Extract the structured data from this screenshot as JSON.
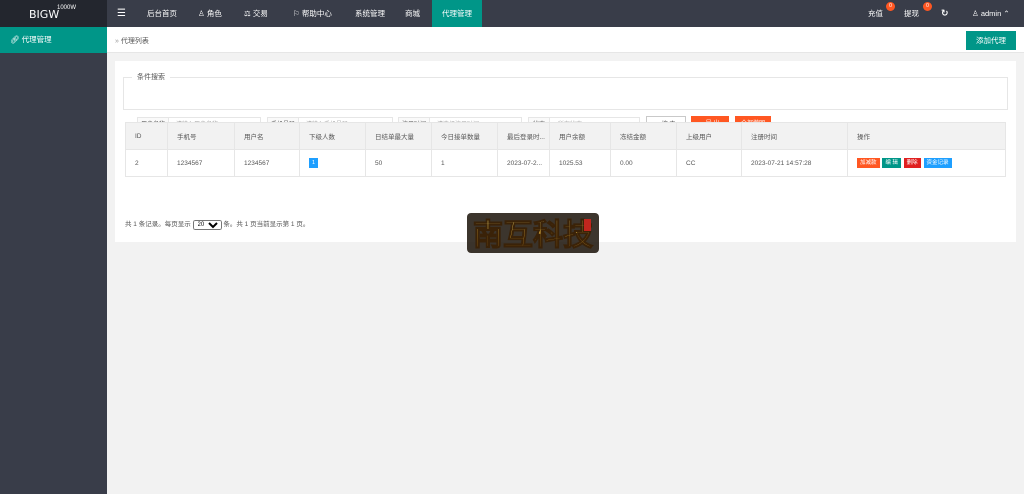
{
  "header": {
    "brand": "BIGW",
    "brand_sup": "1000W",
    "nav": [
      "后台首页",
      "角色",
      "交易",
      "帮助中心",
      "系统管理",
      "商城",
      "代理管理"
    ],
    "recharge": "充值",
    "recharge_badge": "0",
    "withdraw": "提现",
    "withdraw_badge": "0",
    "user": "admin"
  },
  "sidebar": {
    "items": [
      {
        "label": "代理管理"
      }
    ]
  },
  "breadcrumb": "代理列表",
  "add_button": "添加代理",
  "filter": {
    "legend": "条件搜索",
    "username_label": "用户名称",
    "username_placeholder": "请输入用户名称",
    "phone_label": "手机号码",
    "phone_placeholder": "请输入手机号码",
    "regtime_label": "注册时间",
    "regtime_placeholder": "请选择注册时间",
    "status_label": "状态",
    "status_value": "所有状态",
    "search": "搜 索",
    "export": "导 出",
    "batch": "全部撤回"
  },
  "table": {
    "columns": [
      "ID",
      "手机号",
      "用户名",
      "下级人数",
      "日结单最大量",
      "今日接单数量",
      "最后登录时...",
      "用户余额",
      "冻结金额",
      "上级用户",
      "注册时间",
      "操作"
    ],
    "rows": [
      {
        "id": "2",
        "phone": "1234567",
        "username": "1234567",
        "subordinates": "1",
        "max_orders": "50",
        "today_orders": "1",
        "last_login": "2023-07-2...",
        "balance": "1025.53",
        "frozen": "0.00",
        "parent": "CC",
        "reg_time": "2023-07-21 14:57:28",
        "actions": [
          "加减款",
          "编 辑",
          "删除",
          "资金记录"
        ]
      }
    ]
  },
  "pagination": {
    "prefix": "共 1 条记录。每页显示",
    "page_size": "20",
    "suffix": "条。共 1 页当前显示第 1 页。"
  },
  "watermark": "南互科技",
  "colors": {
    "accent": "#009688",
    "warn": "#ff5722",
    "danger": "#f00",
    "info": "#1e9fff",
    "tag_orange": "#ff5722"
  }
}
